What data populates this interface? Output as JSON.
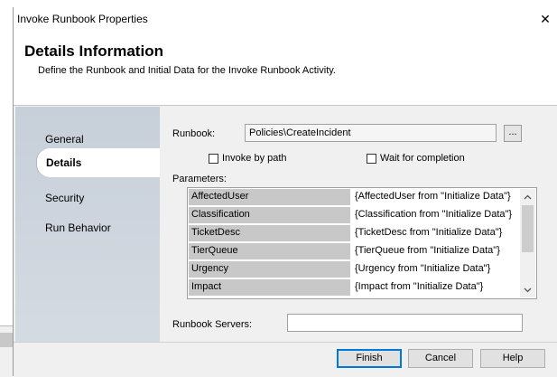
{
  "window": {
    "title": "Invoke Runbook Properties",
    "close_glyph": "✕"
  },
  "header": {
    "title": "Details Information",
    "description": "Define the Runbook and Initial Data for the Invoke Runbook Activity."
  },
  "sidebar": {
    "items": [
      {
        "label": "General",
        "selected": false
      },
      {
        "label": "Details",
        "selected": true
      },
      {
        "label": "Security",
        "selected": false
      },
      {
        "label": "Run Behavior",
        "selected": false
      }
    ]
  },
  "details": {
    "runbook_label": "Runbook:",
    "runbook_value": "Policies\\CreateIncident",
    "browse_label": "...",
    "invoke_by_path_label": "Invoke by path",
    "invoke_by_path_checked": false,
    "wait_for_completion_label": "Wait for completion",
    "wait_for_completion_checked": false,
    "parameters_label": "Parameters:",
    "parameters": [
      {
        "name": "AffectedUser",
        "value": "{AffectedUser from \"Initialize Data\"}"
      },
      {
        "name": "Classification",
        "value": "{Classification from \"Initialize Data\"}"
      },
      {
        "name": "TicketDesc",
        "value": "{TicketDesc from \"Initialize Data\"}"
      },
      {
        "name": "TierQueue",
        "value": "{TierQueue from \"Initialize Data\"}"
      },
      {
        "name": "Urgency",
        "value": "{Urgency from \"Initialize Data\"}"
      },
      {
        "name": "Impact",
        "value": "{Impact from \"Initialize Data\"}"
      }
    ],
    "runbook_servers_label": "Runbook Servers:",
    "runbook_servers_value": ""
  },
  "footer": {
    "finish_label": "Finish",
    "cancel_label": "Cancel",
    "help_label": "Help"
  },
  "colors": {
    "primary_button_border": "#0078d7",
    "sidebar_gradient_top": "#c7cfd9",
    "param_name_bg": "#c8c8c8"
  }
}
